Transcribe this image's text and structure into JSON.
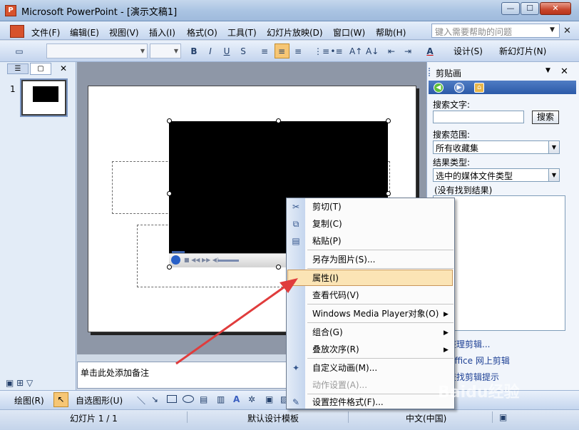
{
  "window": {
    "title": "Microsoft PowerPoint - [演示文稿1]",
    "app_icon_glyph": "P",
    "min_glyph": "—",
    "max_glyph": "☐",
    "close_glyph": "✕"
  },
  "menubar": {
    "items": [
      "文件(F)",
      "编辑(E)",
      "视图(V)",
      "插入(I)",
      "格式(O)",
      "工具(T)",
      "幻灯片放映(D)",
      "窗口(W)",
      "帮助(H)"
    ],
    "help_placeholder": "键入需要帮助的问题",
    "close_glyph": "✕"
  },
  "toolbar": {
    "font_value": "",
    "size_value": "",
    "bold": "B",
    "italic": "I",
    "underline": "U",
    "shadow": "S",
    "design_label": "设计(S)",
    "new_slide_label": "新幻灯片(N)",
    "font_color_glyph": "A"
  },
  "left_pane": {
    "slide_number": "1",
    "close_glyph": "✕"
  },
  "notes": {
    "placeholder": "单击此处添加备注"
  },
  "task_pane": {
    "title": "剪贴画",
    "close_glyph": "✕",
    "search_label": "搜索文字:",
    "search_value": "",
    "search_button": "搜索",
    "scope_label": "搜索范围:",
    "scope_value": "所有收藏集",
    "type_label": "结果类型:",
    "type_value": "选中的媒体文件类型",
    "no_results": "(没有找到结果)",
    "links": [
      "整理剪辑...",
      "Office 网上剪辑",
      "查找剪辑提示"
    ]
  },
  "context_menu": {
    "items": [
      {
        "label": "剪切(T)",
        "icon": "scissors-icon",
        "glyph": "✂",
        "disabled": false
      },
      {
        "label": "复制(C)",
        "icon": "copy-icon",
        "glyph": "⧉",
        "disabled": false
      },
      {
        "label": "粘贴(P)",
        "icon": "paste-icon",
        "glyph": "📋",
        "disabled": false
      },
      {
        "label": "另存为图片(S)...",
        "icon": "",
        "glyph": "",
        "disabled": false
      },
      {
        "label": "属性(I)",
        "icon": "",
        "glyph": "",
        "disabled": false,
        "highlighted": true
      },
      {
        "label": "查看代码(V)",
        "icon": "",
        "glyph": "",
        "disabled": false
      },
      {
        "label": "Windows Media Player对象(O)",
        "icon": "",
        "glyph": "",
        "disabled": false,
        "submenu": true
      },
      {
        "label": "组合(G)",
        "icon": "",
        "glyph": "",
        "disabled": false,
        "submenu": true
      },
      {
        "label": "叠放次序(R)",
        "icon": "",
        "glyph": "",
        "disabled": false,
        "submenu": true
      },
      {
        "label": "自定义动画(M)...",
        "icon": "custom-animation-icon",
        "glyph": "✦",
        "disabled": false
      },
      {
        "label": "动作设置(A)...",
        "icon": "",
        "glyph": "",
        "disabled": true
      },
      {
        "label": "设置控件格式(F)...",
        "icon": "format-control-icon",
        "glyph": "✎",
        "disabled": false
      }
    ],
    "submenu_glyph": "▶"
  },
  "drawbar": {
    "draw_label": "绘图(R)",
    "autoshapes_label": "自选图形(U)"
  },
  "statusbar": {
    "slide_info": "幻灯片 1 / 1",
    "template": "默认设计模板",
    "language": "中文(中国)"
  },
  "watermark": "Baidu经验",
  "colors": {
    "accent_highlight": "#f6c675",
    "arrow": "#e03c3c",
    "titlebar": "#a9c3e2"
  }
}
